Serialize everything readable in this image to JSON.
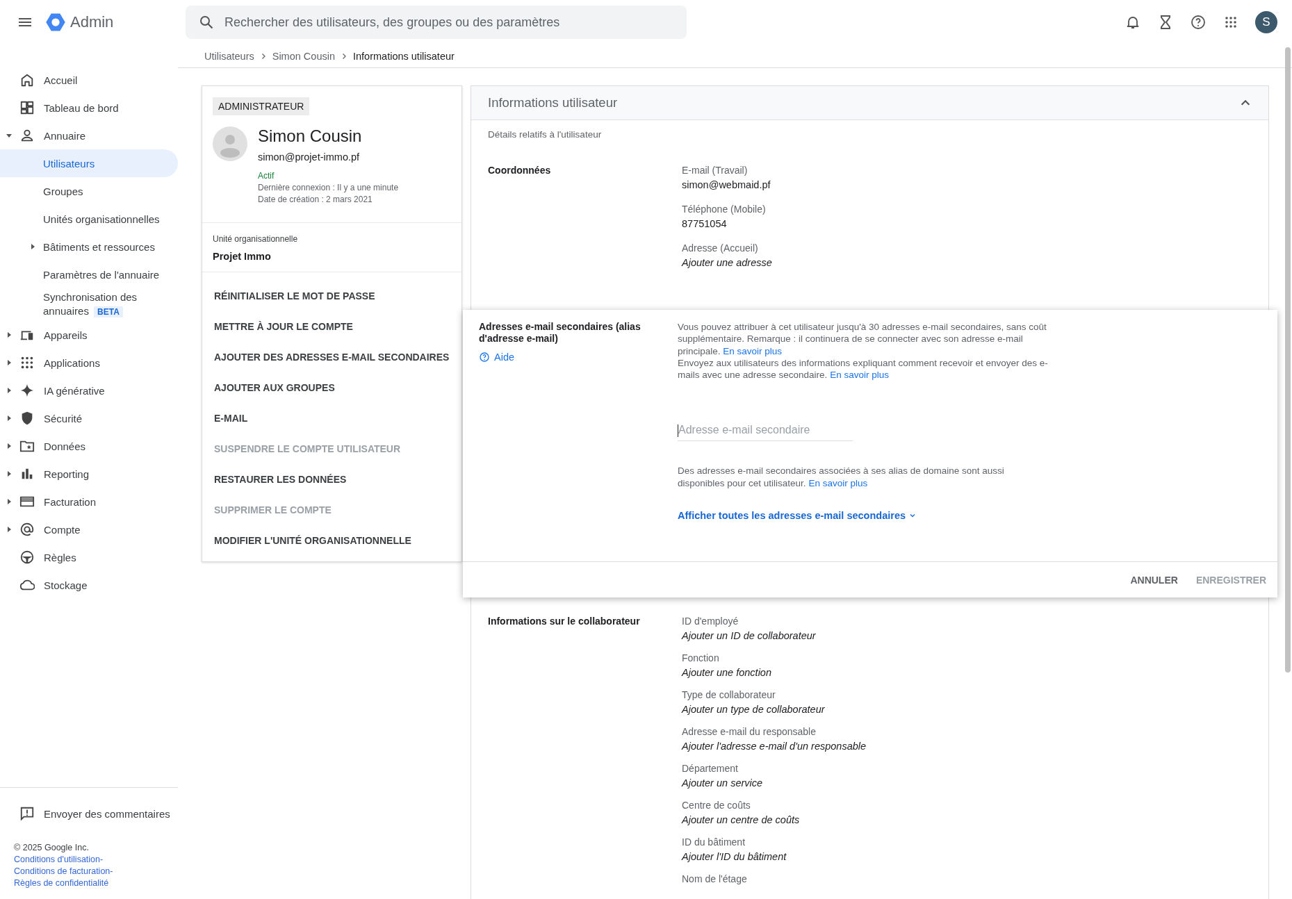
{
  "header": {
    "app_name": "Admin",
    "search": {
      "placeholder": "Rechercher des utilisateurs, des groupes ou des paramètres"
    },
    "avatar_initial": "S"
  },
  "breadcrumb": [
    "Utilisateurs",
    "Simon Cousin",
    "Informations utilisateur"
  ],
  "sidebar": {
    "items": [
      {
        "label": "Accueil",
        "selected": false
      },
      {
        "label": "Tableau de bord",
        "selected": false
      },
      {
        "label": "Annuaire",
        "selected": false,
        "expanded": true,
        "children": [
          {
            "label": "Utilisateurs",
            "selected": true
          },
          {
            "label": "Groupes",
            "selected": false
          },
          {
            "label": "Unités organisationnelles",
            "selected": false
          },
          {
            "label": "Bâtiments et ressources",
            "selected": false,
            "expanded": false
          },
          {
            "label": "Paramètres de l'annuaire",
            "selected": false
          },
          {
            "label": "Synchronisation des annuaires",
            "selected": false,
            "badge": "BETA"
          }
        ]
      },
      {
        "label": "Appareils",
        "selected": false,
        "expanded": false
      },
      {
        "label": "Applications",
        "selected": false,
        "expanded": false
      },
      {
        "label": "IA générative",
        "selected": false,
        "expanded": false
      },
      {
        "label": "Sécurité",
        "selected": false,
        "expanded": false
      },
      {
        "label": "Données",
        "selected": false,
        "expanded": false
      },
      {
        "label": "Reporting",
        "selected": false,
        "expanded": false
      },
      {
        "label": "Facturation",
        "selected": false,
        "expanded": false
      },
      {
        "label": "Compte",
        "selected": false,
        "expanded": false
      },
      {
        "label": "Règles",
        "selected": false
      },
      {
        "label": "Stockage",
        "selected": false
      }
    ],
    "feedback": "Envoyer des commentaires",
    "copyright": "© 2025 Google Inc.",
    "links": [
      "Conditions d'utilisation",
      "Conditions de facturation",
      "Règles de confidentialité"
    ],
    "link_separator": "-"
  },
  "user_card": {
    "role": "ADMINISTRATEUR",
    "name": "Simon Cousin",
    "email": "simon@projet-immo.pf",
    "status": "Actif",
    "last_login": "Dernière connexion : Il y a une minute",
    "created": "Date de création : 2 mars 2021",
    "org_unit_label": "Unité organisationnelle",
    "org_unit": "Projet Immo",
    "actions": [
      {
        "label": "RÉINITIALISER LE MOT DE PASSE",
        "disabled": false
      },
      {
        "label": "METTRE À JOUR LE COMPTE",
        "disabled": false
      },
      {
        "label": "AJOUTER DES ADRESSES E-MAIL SECONDAIRES",
        "disabled": false
      },
      {
        "label": "AJOUTER AUX GROUPES",
        "disabled": false
      },
      {
        "label": "E-MAIL",
        "disabled": false
      },
      {
        "label": "SUSPENDRE LE COMPTE UTILISATEUR",
        "disabled": true
      },
      {
        "label": "RESTAURER LES DONNÉES",
        "disabled": false
      },
      {
        "label": "SUPPRIMER LE COMPTE",
        "disabled": true
      },
      {
        "label": "MODIFIER L'UNITÉ ORGANISATIONNELLE",
        "disabled": false
      }
    ]
  },
  "info_panel": {
    "title": "Informations utilisateur",
    "expanded": true,
    "subtitle": "Détails relatifs à l'utilisateur",
    "contact": {
      "title": "Coordonnées",
      "fields": [
        {
          "label": "E-mail (Travail)",
          "value": "simon@webmaid.pf",
          "kind": "value"
        },
        {
          "label": "Téléphone (Mobile)",
          "value": "87751054",
          "kind": "value"
        },
        {
          "label": "Adresse (Accueil)",
          "value": "Ajouter une adresse",
          "kind": "add"
        }
      ]
    },
    "alias_editor": {
      "title": "Adresses e-mail secondaires (alias d'adresse e-mail)",
      "help": "Aide",
      "paragraphs": [
        {
          "text": "Vous pouvez attribuer à cet utilisateur jusqu'à 30 adresses e-mail secondaires, sans coût supplémentaire. Remarque : il continuera de se connecter avec son adresse e-mail principale.",
          "link": "En savoir plus"
        },
        {
          "text": "Envoyez aux utilisateurs des informations expliquant comment recevoir et envoyer des e-mails avec une adresse secondaire.",
          "link": "En savoir plus"
        }
      ],
      "input": {
        "placeholder": "Adresse e-mail secondaire",
        "focused": true
      },
      "note": {
        "text": "Des adresses e-mail secondaires associées à ses alias de domaine sont aussi disponibles pour cet utilisateur.",
        "link": "En savoir plus"
      },
      "show_all": "Afficher toutes les adresses e-mail secondaires",
      "buttons": [
        {
          "label": "ANNULER",
          "disabled": false
        },
        {
          "label": "ENREGISTRER",
          "disabled": true
        }
      ]
    },
    "employee": {
      "title": "Informations sur le collaborateur",
      "fields": [
        {
          "label": "ID d'employé",
          "value": "Ajouter un ID de collaborateur",
          "kind": "add"
        },
        {
          "label": "Fonction",
          "value": "Ajouter une fonction",
          "kind": "add"
        },
        {
          "label": "Type de collaborateur",
          "value": "Ajouter un type de collaborateur",
          "kind": "add"
        },
        {
          "label": "Adresse e-mail du responsable",
          "value": "Ajouter l'adresse e-mail d'un responsable",
          "kind": "add"
        },
        {
          "label": "Département",
          "value": "Ajouter un service",
          "kind": "add"
        },
        {
          "label": "Centre de coûts",
          "value": "Ajouter un centre de coûts",
          "kind": "add"
        },
        {
          "label": "ID du bâtiment",
          "value": "Ajouter l'ID du bâtiment",
          "kind": "add"
        },
        {
          "label": "Nom de l'étage"
        }
      ]
    }
  }
}
